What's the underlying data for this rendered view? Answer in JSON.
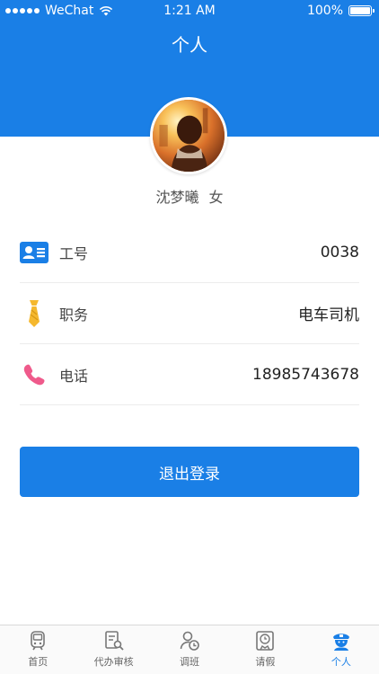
{
  "status_bar": {
    "carrier": "WeChat",
    "time": "1:21 AM",
    "battery": "100%"
  },
  "header": {
    "title": "个人"
  },
  "profile": {
    "name": "沈梦曦",
    "gender": "女"
  },
  "info_rows": [
    {
      "label": "工号",
      "value": "0038",
      "icon": "id-card-icon"
    },
    {
      "label": "职务",
      "value": "电车司机",
      "icon": "tie-icon"
    },
    {
      "label": "电话",
      "value": "18985743678",
      "icon": "phone-icon"
    }
  ],
  "logout": {
    "label": "退出登录"
  },
  "tabbar": {
    "items": [
      {
        "label": "首页",
        "icon": "train-icon",
        "active": false
      },
      {
        "label": "代办审核",
        "icon": "review-doc-icon",
        "active": false
      },
      {
        "label": "调班",
        "icon": "shift-swap-icon",
        "active": false
      },
      {
        "label": "请假",
        "icon": "leave-icon",
        "active": false
      },
      {
        "label": "个人",
        "icon": "driver-icon",
        "active": true
      }
    ]
  },
  "colors": {
    "primary": "#1a7fe6",
    "id_icon": "#1a7fe6",
    "tie_icon": "#f5b82e",
    "phone_icon": "#ef5a8b"
  }
}
